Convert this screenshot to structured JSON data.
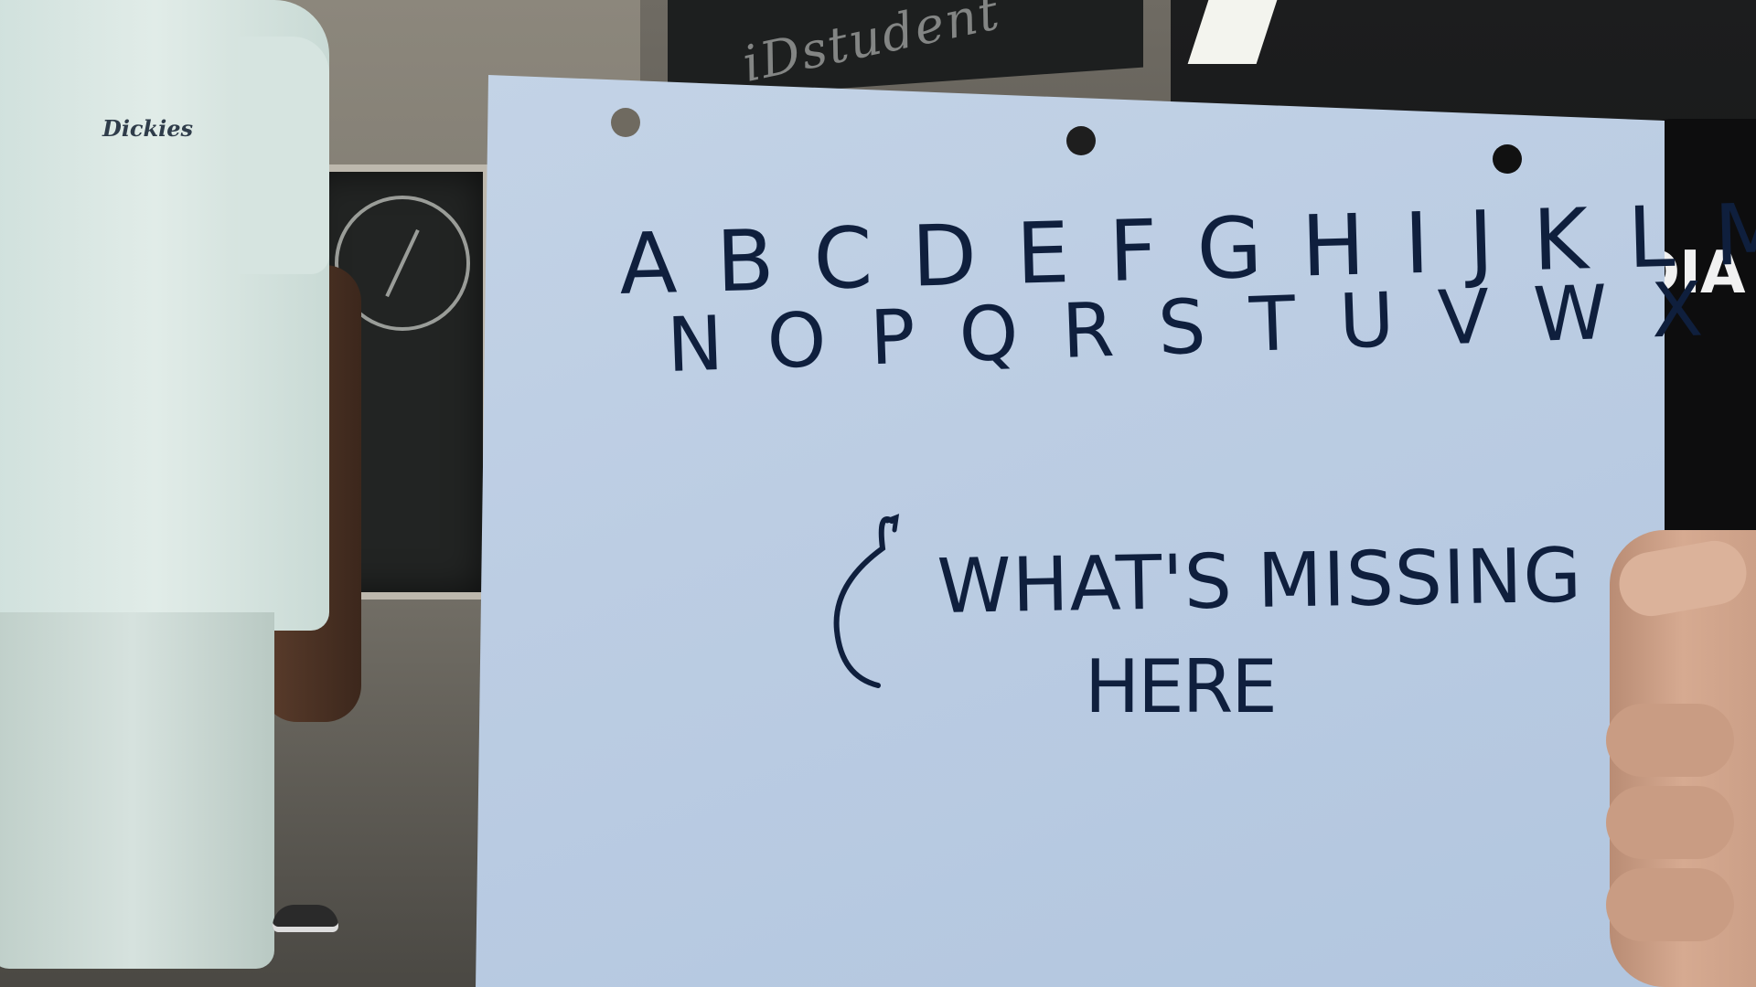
{
  "scene": {
    "sign": {
      "alphabet_line_1": "A B C D E F G H I J K L M",
      "alphabet_line_2": "N O P Q R S T U V W X  Z",
      "question_line_1": "WHAT'S MISSING",
      "question_line_2": "HERE"
    },
    "background_chalkboard_text": "iDstudent",
    "shirt_logo_text": "Dickies",
    "right_shirt_text": "DIA"
  }
}
